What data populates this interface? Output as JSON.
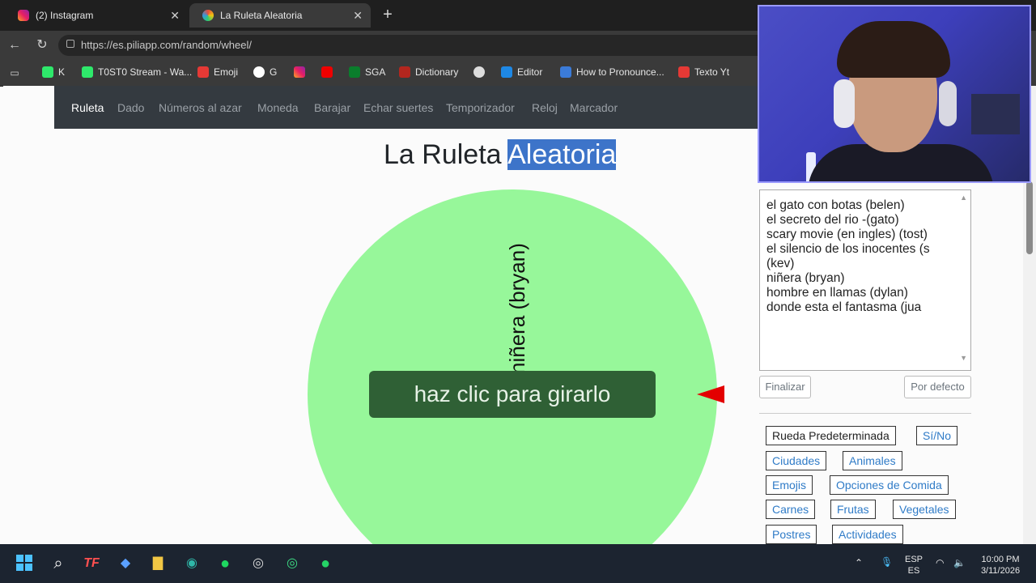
{
  "browser": {
    "tabs": [
      {
        "title": "(2) Instagram",
        "icon": "instagram-icon",
        "active": false
      },
      {
        "title": "La Ruleta Aleatoria",
        "icon": "wheel-favicon-icon",
        "active": true
      }
    ],
    "url": "https://es.piliapp.com/random/wheel/",
    "bookmarks": [
      {
        "label": "K",
        "icon": "kick-icon"
      },
      {
        "label": "T0ST0 Stream - Wa...",
        "icon": "kick-icon"
      },
      {
        "label": "Emoji",
        "icon": "emoji-icon"
      },
      {
        "label": "G",
        "icon": "google-icon"
      },
      {
        "label": "",
        "icon": "instagram-icon"
      },
      {
        "label": "",
        "icon": "youtube-icon"
      },
      {
        "label": "SGA",
        "icon": "sga-icon"
      },
      {
        "label": "Dictionary",
        "icon": "dictionary-icon"
      },
      {
        "label": "",
        "icon": "openai-icon"
      },
      {
        "label": "Editor",
        "icon": "editor-icon"
      },
      {
        "label": "How to Pronounce...",
        "icon": "pronounce-icon"
      },
      {
        "label": "Texto Yt",
        "icon": "texto-icon"
      }
    ]
  },
  "site": {
    "nav": [
      "Ruleta",
      "Dado",
      "Números al azar",
      "Moneda",
      "Barajar",
      "Echar suertes",
      "Temporizador",
      "Reloj",
      "Marcador"
    ],
    "title_prefix": "La Ruleta",
    "title_highlight": "Aleatoria",
    "wheel": {
      "color": "#97f79a",
      "visible_label": "niñera (bryan)",
      "spin_button": "haz clic para girarlo",
      "pointer_color": "#e30000"
    },
    "entries": [
      "el gato con botas (belen)",
      "el secreto del rio -(gato)",
      "scary movie (en ingles) (tost)",
      "el silencio de los inocentes (s",
      " (kev)",
      "niñera (bryan)",
      "hombre en llamas (dylan)",
      "donde esta el fantasma (jua"
    ],
    "buttons": {
      "finalize": "Finalizar",
      "default": "Por defecto"
    },
    "categories": [
      "Rueda Predeterminada",
      "Sí/No",
      "Ciudades",
      "Animales",
      "Emojis",
      "Opciones de Comida",
      "Carnes",
      "Frutas",
      "Vegetales",
      "Postres",
      "Actividades"
    ]
  },
  "taskbar": {
    "lang": "ESP",
    "lang_sub": "ES",
    "time": "10:00 PM",
    "date": "3/11/2026"
  }
}
